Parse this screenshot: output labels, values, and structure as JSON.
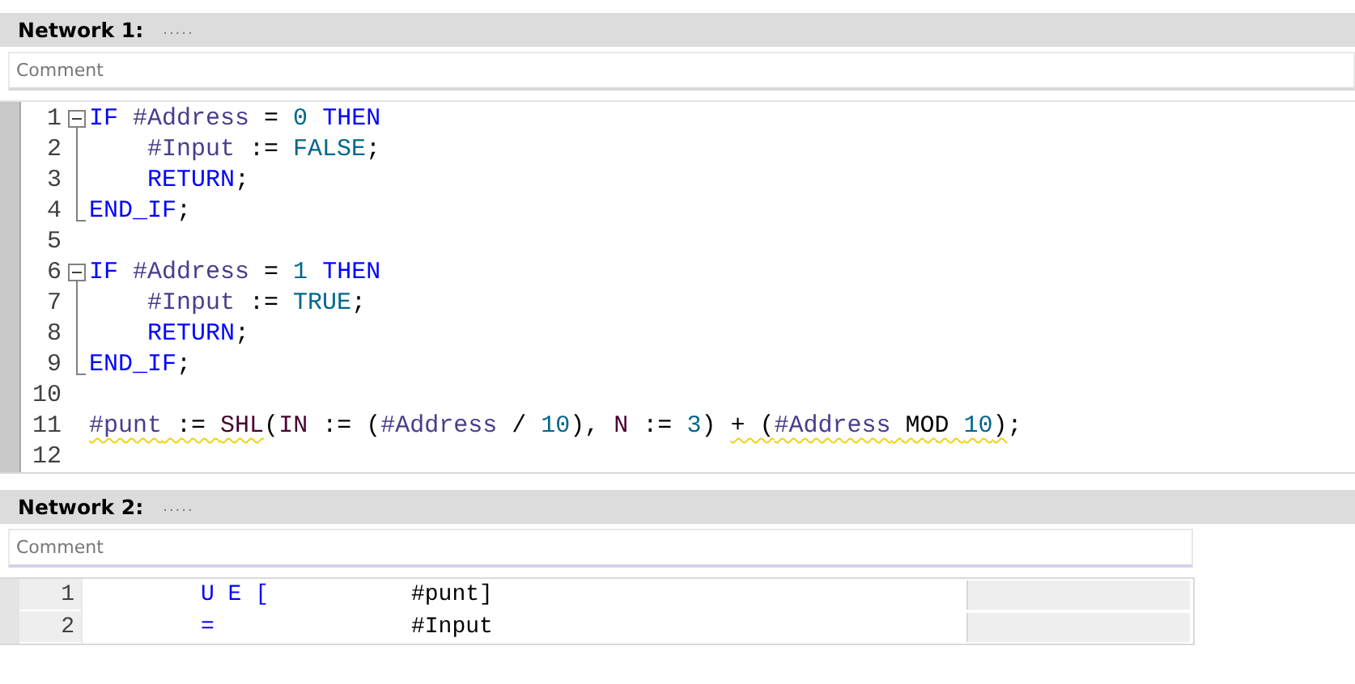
{
  "networks": [
    {
      "title": "Network 1:",
      "dots": ".....",
      "comment": {
        "placeholder": "Comment"
      },
      "kind": "scl",
      "lines": [
        {
          "num": "1",
          "kind": "block",
          "tokens": [
            {
              "t": "IF ",
              "color": "#0000ff"
            },
            {
              "t": "#Address",
              "color": "#4b3c8c"
            },
            {
              "t": " = ",
              "color": "#000000"
            },
            {
              "t": "0",
              "color": "#00668c"
            },
            {
              "t": " THEN",
              "color": "#0000ff"
            }
          ],
          "children": [
            {
              "num": "2",
              "tokens": [
                {
                  "t": "#Input",
                  "color": "#4b3c8c"
                },
                {
                  "t": " := ",
                  "color": "#000000"
                },
                {
                  "t": "FALSE",
                  "color": "#00668c"
                },
                {
                  "t": ";",
                  "color": "#000000"
                }
              ]
            },
            {
              "num": "3",
              "tokens": [
                {
                  "t": "RETURN",
                  "color": "#0000ff"
                },
                {
                  "t": ";",
                  "color": "#000000"
                }
              ]
            }
          ]
        },
        {
          "num": "4",
          "kind": "block-end",
          "tokens": [
            {
              "t": "END_IF",
              "color": "#0000ff"
            },
            {
              "t": ";",
              "color": "#000000"
            }
          ]
        },
        {
          "num": "5",
          "kind": "plain"
        },
        {
          "num": "6",
          "kind": "block",
          "tokens": [
            {
              "t": "IF ",
              "color": "#0000ff"
            },
            {
              "t": "#Address",
              "color": "#4b3c8c"
            },
            {
              "t": " = ",
              "color": "#000000"
            },
            {
              "t": "1",
              "color": "#00668c"
            },
            {
              "t": " THEN",
              "color": "#0000ff"
            }
          ],
          "children": [
            {
              "num": "7",
              "tokens": [
                {
                  "t": "#Input",
                  "color": "#4b3c8c"
                },
                {
                  "t": " := ",
                  "color": "#000000"
                },
                {
                  "t": "TRUE",
                  "color": "#00668c"
                },
                {
                  "t": ";",
                  "color": "#000000"
                }
              ]
            },
            {
              "num": "8",
              "tokens": [
                {
                  "t": "RETURN",
                  "color": "#0000ff"
                },
                {
                  "t": ";",
                  "color": "#000000"
                }
              ]
            }
          ]
        },
        {
          "num": "9",
          "kind": "block-end",
          "tokens": [
            {
              "t": "END_IF",
              "color": "#0000ff"
            },
            {
              "t": ";",
              "color": "#000000"
            }
          ]
        },
        {
          "num": "10",
          "kind": "plain"
        },
        {
          "num": "11",
          "kind": "plain",
          "tokens": [
            {
              "t": "#punt",
              "color": "#4b3c8c",
              "warn": true
            },
            {
              "t": " := ",
              "color": "#000000",
              "warn": true
            },
            {
              "t": "SHL",
              "color": "#4a0030",
              "warn": true
            },
            {
              "t": "(",
              "color": "#000000",
              "warn": false
            },
            {
              "t": "IN",
              "color": "#4a0030",
              "warn": false
            },
            {
              "t": " := (",
              "color": "#000000",
              "warn": false
            },
            {
              "t": "#Address",
              "color": "#4b3c8c",
              "warn": false
            },
            {
              "t": " / ",
              "color": "#000000",
              "warn": false
            },
            {
              "t": "10",
              "color": "#00668c",
              "warn": false
            },
            {
              "t": "), ",
              "color": "#000000",
              "warn": false
            },
            {
              "t": "N",
              "color": "#4a0030",
              "warn": false
            },
            {
              "t": " := ",
              "color": "#000000",
              "warn": false
            },
            {
              "t": "3",
              "color": "#00668c",
              "warn": false
            },
            {
              "t": ") ",
              "color": "#000000",
              "warn": false
            },
            {
              "t": "+ (",
              "color": "#000000",
              "warn": true
            },
            {
              "t": "#Address",
              "color": "#4b3c8c",
              "warn": true
            },
            {
              "t": " MOD ",
              "color": "#000000",
              "warn": true
            },
            {
              "t": "10",
              "color": "#00668c",
              "warn": true
            },
            {
              "t": ")",
              "color": "#000000",
              "warn": true
            },
            {
              "t": ";",
              "color": "#000000",
              "warn": false
            }
          ]
        },
        {
          "num": "12",
          "kind": "plain"
        }
      ]
    },
    {
      "title": "Network 2:",
      "dots": ".....",
      "comment": {
        "placeholder": "Comment"
      },
      "kind": "stl",
      "rows": [
        {
          "num": "1",
          "instruction": "U E [",
          "operand": "#punt]"
        },
        {
          "num": "2",
          "instruction": "=",
          "operand": "#Input"
        }
      ]
    }
  ]
}
